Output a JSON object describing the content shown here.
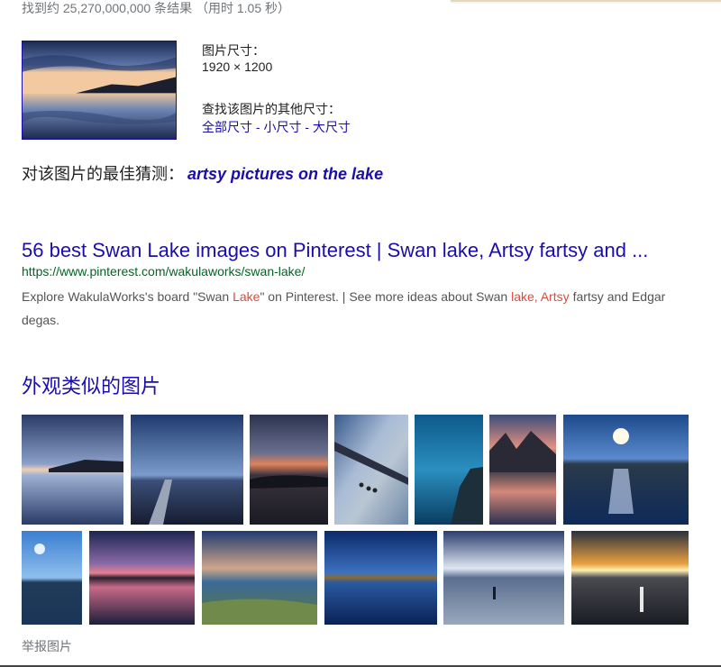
{
  "stats": {
    "text": "找到约 25,270,000,000 条结果 （用时 1.05 秒）"
  },
  "image_info": {
    "size_label": "图片尺寸：",
    "size_value": "1920 × 1200",
    "other_sizes_label": "查找该图片的其他尺寸：",
    "links": {
      "all": "全部尺寸",
      "small": "小尺寸",
      "large": "大尺寸",
      "separator": " - "
    }
  },
  "best_guess": {
    "label": "对该图片的最佳猜测：",
    "query": "artsy pictures on the lake"
  },
  "result": {
    "title": "56 best Swan Lake images on Pinterest | Swan lake, Artsy fartsy and ...",
    "url": "https://www.pinterest.com/wakulaworks/swan-lake/",
    "snippet": {
      "part1": "Explore WakulaWorks's board \"Swan ",
      "hl1": "Lake",
      "part2": "\" on Pinterest. | See more ideas about Swan ",
      "hl2": "lake,",
      "part3": " ",
      "hl3": "Artsy",
      "part4": " fartsy and Edgar degas."
    }
  },
  "similar": {
    "heading": "外观类似的图片",
    "images": [
      "lake-reflection-dusk-image",
      "boardwalk-lake-image",
      "sunset-over-lake-image",
      "ducks-on-lake-image",
      "blue-lake-shore-image",
      "mountain-lake-sunset-image",
      "sun-glare-lake-image",
      "blue-sky-lake-image",
      "purple-sunset-lake-image",
      "clouds-grass-lake-image",
      "deep-blue-lake-image",
      "person-wading-lake-image",
      "golden-sunset-lake-image"
    ]
  },
  "report": {
    "label": "举报图片"
  },
  "colors": {
    "link": "#1a0dab",
    "url_green": "#006621",
    "highlight": "#dd4b39",
    "snippet_gray": "#545454"
  }
}
